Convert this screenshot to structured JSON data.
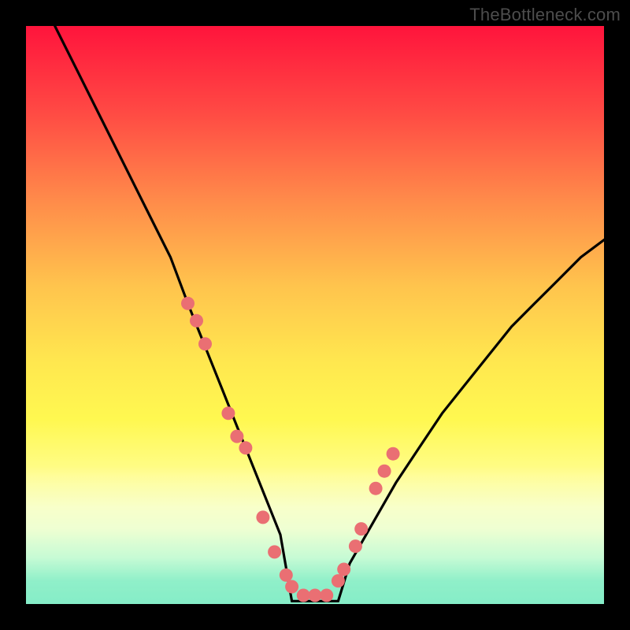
{
  "watermark": "TheBottleneck.com",
  "chart_data": {
    "type": "line",
    "title": "",
    "xlabel": "",
    "ylabel": "",
    "xlim": [
      0,
      100
    ],
    "ylim": [
      0,
      100
    ],
    "grid": false,
    "series": [
      {
        "name": "curve",
        "color": "#000000",
        "x": [
          5,
          9,
          13,
          17,
          21,
          25,
          28,
          30,
          32,
          34,
          36,
          38,
          40,
          42,
          44,
          46,
          48,
          50,
          52,
          54,
          56,
          60,
          64,
          68,
          72,
          76,
          80,
          84,
          88,
          92,
          96,
          100
        ],
        "y": [
          100,
          92,
          84,
          76,
          68,
          60,
          52,
          47,
          42,
          37,
          32,
          27,
          22,
          17,
          12,
          7,
          3,
          0.5,
          0.5,
          3,
          7,
          14,
          21,
          27,
          33,
          38,
          43,
          48,
          52,
          56,
          60,
          63
        ]
      },
      {
        "name": "dots",
        "color": "#ea6f73",
        "type": "scatter",
        "x": [
          28,
          29.5,
          31,
          35,
          36.5,
          38,
          41,
          43,
          45,
          46,
          48,
          50,
          52,
          54,
          55,
          57,
          58,
          60.5,
          62,
          63.5
        ],
        "y": [
          52,
          49,
          45,
          33,
          29,
          27,
          15,
          9,
          5,
          3,
          1.5,
          1.5,
          1.5,
          4,
          6,
          10,
          13,
          20,
          23,
          26
        ]
      }
    ],
    "flat_bottom_range": [
      46,
      54
    ]
  },
  "colors": {
    "background": "#000000",
    "gradient_top": "#ff143c",
    "gradient_bottom": "#16dc95",
    "curve": "#000000",
    "dots": "#ea6f73",
    "watermark": "#4d4d4d"
  }
}
